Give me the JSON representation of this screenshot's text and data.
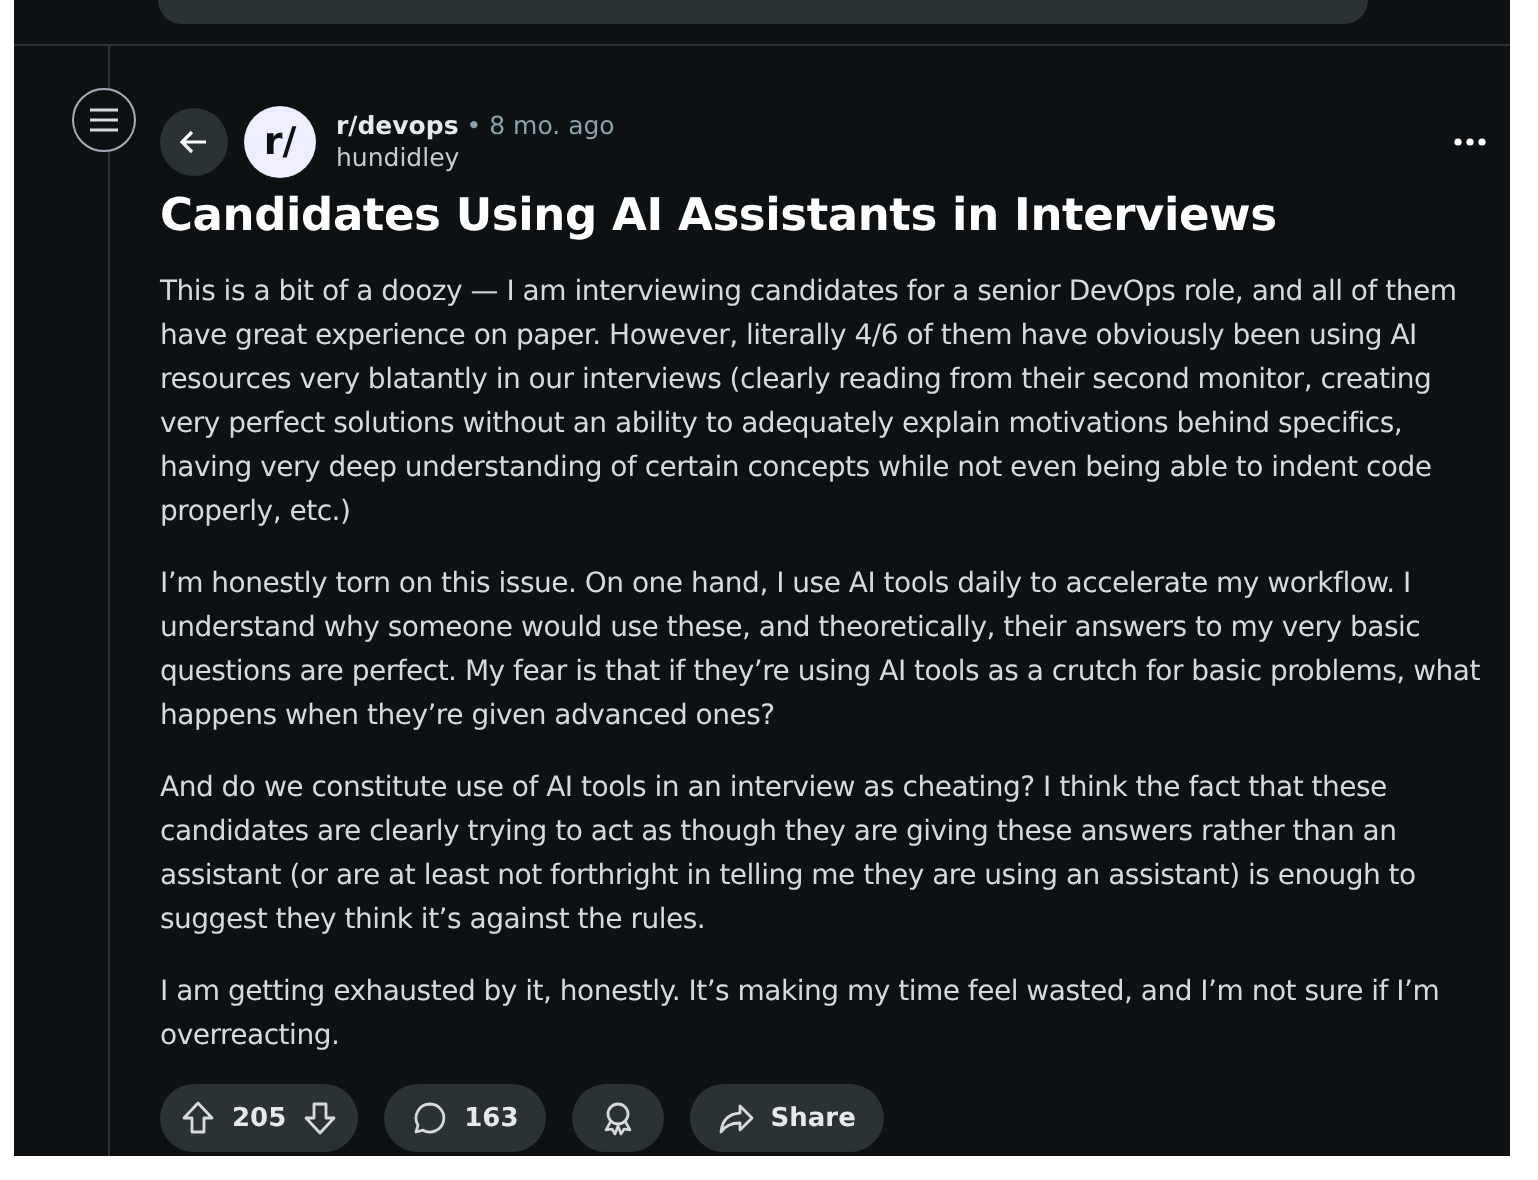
{
  "post": {
    "subreddit": "r/devops",
    "separator": "•",
    "age": "8 mo. ago",
    "author": "hundidley",
    "avatar_text": "r/",
    "title": "Candidates Using AI Assistants in Interviews",
    "paragraphs": [
      "This is a bit of a doozy — I am interviewing candidates for a senior DevOps role, and all of them have great experience on paper. However, literally 4/6 of them have obviously been using AI resources very blatantly in our interviews (clearly reading from their second monitor, creating very perfect solutions without an ability to adequately explain motivations behind specifics, having very deep understanding of certain concepts while not even being able to indent code properly, etc.)",
      "I’m honestly torn on this issue. On one hand, I use AI tools daily to accelerate my workflow. I understand why someone would use these, and theoretically, their answers to my very basic questions are perfect. My fear is that if they’re using AI tools as a crutch for basic problems, what happens when they’re given advanced ones?",
      "And do we constitute use of AI tools in an interview as cheating? I think the fact that these candidates are clearly trying to act as though they are giving these answers rather than an assistant (or are at least not forthright in telling me they are using an assistant) is enough to suggest they think it’s against the rules.",
      "I am getting exhausted by it, honestly. It’s making my time feel wasted, and I’m not sure if I’m overreacting."
    ]
  },
  "actions": {
    "votes": "205",
    "comments": "163",
    "share": "Share"
  }
}
